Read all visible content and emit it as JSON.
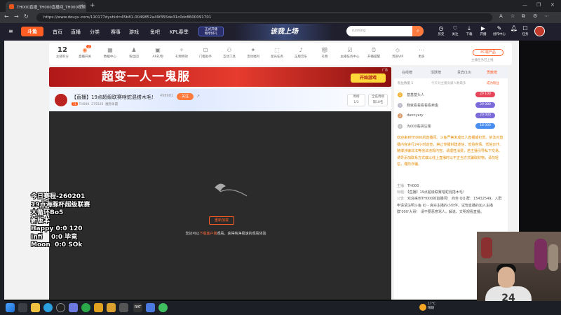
{
  "browser": {
    "tab_title": "TH000直播_TH000直播间_TH000视频",
    "url": "https://www.douyu.com/110177dyshid=45b81-0049852a49f355de31c0dc8600091701"
  },
  "site": {
    "logo": "斗鱼",
    "nav": [
      "首页",
      "直播",
      "分类",
      "赛事",
      "游戏",
      "鱼吧"
    ],
    "kpl": "KPL春季",
    "promo_line1": "正式开播",
    "promo_line2": "畅享好礼",
    "banner": "该我上场",
    "search_placeholder": "running",
    "header_icons": [
      {
        "label": "历史",
        "icon": "history-icon"
      },
      {
        "label": "关注",
        "icon": "heart-icon"
      },
      {
        "label": "下载",
        "icon": "download-icon"
      },
      {
        "label": "开播",
        "icon": "broadcast-icon"
      },
      {
        "label": "创作中心",
        "icon": "creator-icon"
      },
      {
        "label": "任务",
        "icon": "task-icon"
      }
    ]
  },
  "toolbar": {
    "level": "12",
    "level_label": "主播积分",
    "items": [
      {
        "label": "直播开关",
        "badge": "2"
      },
      {
        "label": "数据中心"
      },
      {
        "label": "粉丝团"
      },
      {
        "label": "AR礼物"
      },
      {
        "label": "礼物特效"
      },
      {
        "label": "门槛助手"
      },
      {
        "label": "互动工具"
      },
      {
        "label": "活动福利"
      },
      {
        "label": "星光任务"
      },
      {
        "label": "正版音乐"
      },
      {
        "label": "礼物"
      },
      {
        "label": "主播任务中心"
      },
      {
        "label": "开播提醒"
      },
      {
        "label": "贵族VIP"
      },
      {
        "label": "更多"
      }
    ],
    "pc_button": "PC端产品",
    "pc_tip": "主播任务已上线"
  },
  "ad": {
    "text": "超变一人一鬼服",
    "button": "开始游戏",
    "label": "广告"
  },
  "room": {
    "title": "【直播】19点超级联赛啥蛇混搭木毛!",
    "follow_count": "498981",
    "follow_btn": "关注",
    "level_badge": "71",
    "anchor": "TH000",
    "room_no": "275520",
    "category": "魔兽争霸",
    "rank_title": "周榜",
    "rank_value": "1/3",
    "gift_title": "全名周榜",
    "gift_value": "第10名"
  },
  "player": {
    "refresh": "重新加载",
    "tip_prefix": "您还可以",
    "tip_link": "下载客户端",
    "tip_suffix": "观看，获得纯净极速的观看体验"
  },
  "chat": {
    "tabs": [
      "在线榜",
      "活跃榜",
      "贵宾(10)",
      "贡献榜"
    ],
    "rank_hint": "粉丝数量 5",
    "rank_hint2": "今天对主播贡献人数最多",
    "rank_hint3": "成为粉丝",
    "ranks": [
      {
        "n": "1",
        "name": "基基基头人",
        "score": "29 100",
        "color": "#e6455a"
      },
      {
        "n": "2",
        "name": "我就看看看看看卖金",
        "score": "29 000",
        "color": "#7a6bd8"
      },
      {
        "n": "3",
        "name": "dannyary",
        "score": "20 000",
        "color": "#7a6bd8"
      },
      {
        "n": "4",
        "name": "为000看拼注楼",
        "score": "18 000",
        "color": "#4a8ef0"
      }
    ],
    "notice": "欢迎来到TH000的直播间。斗鱼严禁未成年人直播或打赏。依法对直播内容进行24小时巡查，禁止传播封建迷信、低俗色情、低俗炒作、赌博涉嫌非法等违法违规内容。请理性消费，若主播引导私下交易、诱导添加联系方式或以线上直播时以不正当方式骗取财物，请勿轻信，谨防诈骗。",
    "msg1_label": "主播：",
    "msg1_name": "TH000",
    "msg1_title_label": "标题：",
    "msg1_title": "【直播】19点超级联赛啥蛇混搭木毛!",
    "msg2_label": "公告：",
    "msg2_text": "欢迎来到TH000的直播间！ 商务 QQ 群：15432549，入群申请请注明斗鱼 ID - 真实主播的小伙伴，试管直播的加入主播群'000'大哥！ 请不要恶意骂人。解说、文明观看直播。"
  },
  "overlay": [
    "今日赛程-260201",
    "19点海豚杯超级联赛",
    "大循环Bo5",
    "新版本",
    "Happy 0:0 120",
    "Infi    0:0 毕竟",
    "Moon  0:0 SOk"
  ],
  "webcam": {
    "shirt_number": "24"
  },
  "taskbar": {
    "weather_temp": "17°C",
    "weather_desc": "晴朗",
    "time": "",
    "date": ""
  }
}
